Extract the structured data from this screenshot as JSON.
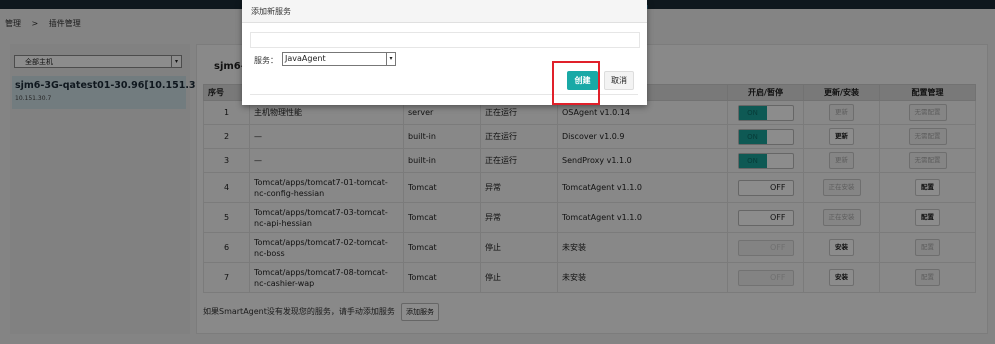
{
  "breadcrumb": {
    "root": "管理",
    "sep": ">",
    "current": "插件管理"
  },
  "sidebar": {
    "host_filter": "全部主机",
    "host_name": "sjm6-3G-qatest01-30.96[10.151.30.7]",
    "host_ip": "10.151.30.7"
  },
  "main": {
    "host_title": "sjm6-3",
    "columns": [
      "序号",
      "",
      "",
      "",
      "",
      "开启/暂停",
      "更新/安装",
      "配置管理"
    ],
    "rows": [
      {
        "no": "1",
        "name": "主机物理性能",
        "type": "server",
        "status": "正在运行",
        "version": "OSAgent v1.0.14",
        "toggle": "ON",
        "update": "更新",
        "config": "无需配置"
      },
      {
        "no": "2",
        "name": "—",
        "type": "built-in",
        "status": "正在运行",
        "version": "Discover v1.0.9",
        "toggle": "ON",
        "update": "更新",
        "config": "无需配置"
      },
      {
        "no": "3",
        "name": "—",
        "type": "built-in",
        "status": "正在运行",
        "version": "SendProxy v1.1.0",
        "toggle": "ON",
        "update": "更新",
        "config": "无需配置"
      },
      {
        "no": "4",
        "name": "Tomcat/apps/tomcat7-01-tomcat-nc-config-hessian",
        "type": "Tomcat",
        "status": "异常",
        "version": "TomcatAgent v1.1.0",
        "toggle": "OFF",
        "update": "正在安装",
        "config": "配置"
      },
      {
        "no": "5",
        "name": "Tomcat/apps/tomcat7-03-tomcat-nc-api-hessian",
        "type": "Tomcat",
        "status": "异常",
        "version": "TomcatAgent v1.1.0",
        "toggle": "OFF",
        "update": "正在安装",
        "config": "配置"
      },
      {
        "no": "6",
        "name": "Tomcat/apps/tomcat7-02-tomcat-nc-boss",
        "type": "Tomcat",
        "status": "停止",
        "version": "未安装",
        "toggle": "OFF",
        "update": "安装",
        "config": "配置"
      },
      {
        "no": "7",
        "name": "Tomcat/apps/tomcat7-08-tomcat-nc-cashier-wap",
        "type": "Tomcat",
        "status": "停止",
        "version": "未安装",
        "toggle": "OFF",
        "update": "安装",
        "config": "配置"
      }
    ],
    "footer_note": "如果SmartAgent没有发现您的服务，请手动添加服务",
    "add_service_button": "添加服务"
  },
  "modal": {
    "title": "添加新服务",
    "service_label": "服务：",
    "service_value": "JavaAgent",
    "create_button": "创建",
    "cancel_button": "取消"
  },
  "colors": {
    "accent": "#19a9a6",
    "highlight": "#e0202a",
    "topbar": "#1b2b36"
  }
}
